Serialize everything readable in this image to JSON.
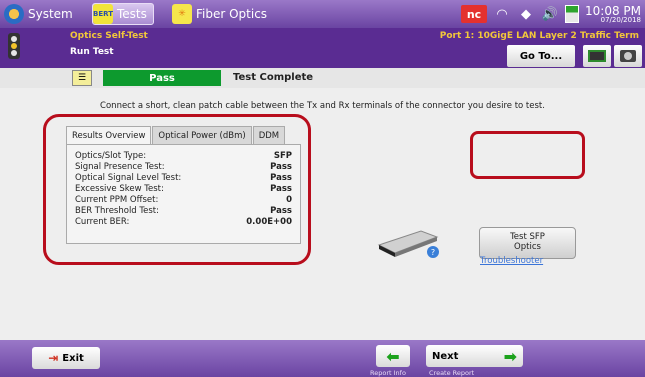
{
  "topbar": {
    "system_label": "System",
    "tests_label": "Tests",
    "tests_icon_text": "BERT",
    "fiber_label": "Fiber Optics",
    "status_badge": "nc",
    "clock_time": "10:08 PM",
    "clock_date": "07/20/2018"
  },
  "header": {
    "subtitle": "Optics Self-Test",
    "test_name": "Run Test",
    "port_info": "Port 1: 10GigE LAN Layer 2 Traffic Term",
    "goto_label": "Go To..."
  },
  "status": {
    "result": "Pass",
    "message": "Test Complete",
    "result_color": "#0d9a2e"
  },
  "main": {
    "instruction": "Connect a short, clean patch cable between the Tx and Rx terminals of the connector you desire to test.",
    "tabs": [
      {
        "label": "Results Overview",
        "active": true
      },
      {
        "label": "Optical Power (dBm)",
        "active": false
      },
      {
        "label": "DDM",
        "active": false
      }
    ],
    "results": [
      {
        "label": "Optics/Slot Type:",
        "value": "SFP"
      },
      {
        "label": "Signal Presence Test:",
        "value": "Pass"
      },
      {
        "label": "Optical Signal Level Test:",
        "value": "Pass"
      },
      {
        "label": "Excessive Skew Test:",
        "value": "Pass"
      },
      {
        "label": "Current PPM Offset:",
        "value": "0"
      },
      {
        "label": "BER Threshold Test:",
        "value": "Pass"
      },
      {
        "label": "Current BER:",
        "value": "0.00E+00"
      }
    ],
    "test_button_label": "Test SFP\nOptics",
    "troubleshooter_label": "Troubleshooter",
    "highlight_color": "#b80d1c"
  },
  "footer": {
    "exit_label": "Exit",
    "report_info_caption": "Report Info",
    "next_label": "Next",
    "create_report_caption": "Create Report"
  }
}
